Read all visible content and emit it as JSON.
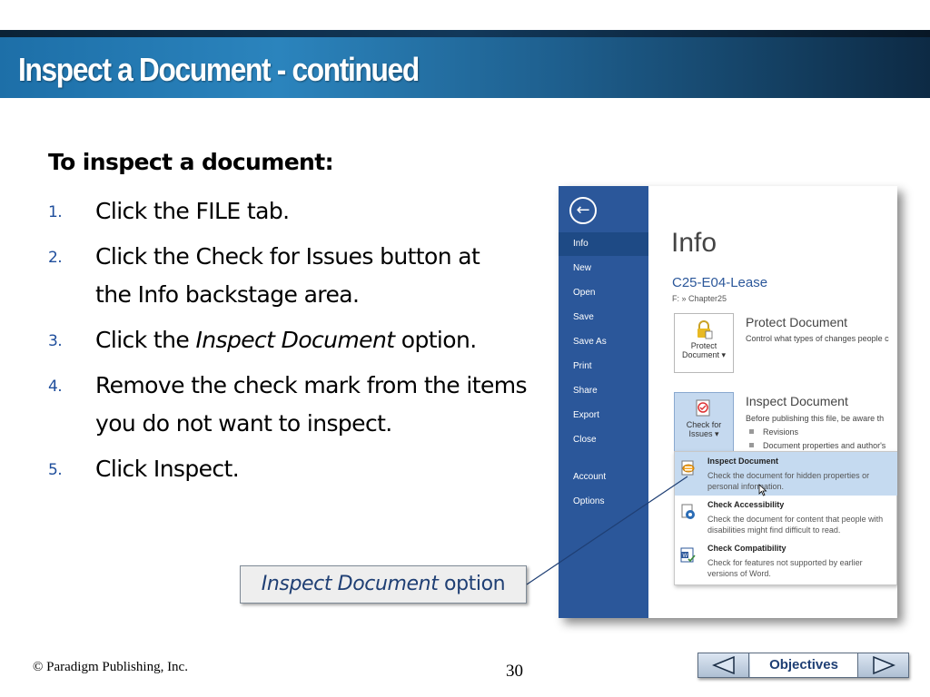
{
  "title": "Inspect a Document - continued",
  "heading": "To inspect a document:",
  "steps": [
    {
      "num": "1.",
      "text": "Click the FILE tab."
    },
    {
      "num": "2.",
      "text": "Click the Check for Issues button at the Info backstage area."
    },
    {
      "num": "3.",
      "pre": "Click the ",
      "em": "Inspect Document",
      "post": " option."
    },
    {
      "num": "4.",
      "text": "Remove the check mark from the items you do not want to inspect."
    },
    {
      "num": "5.",
      "text": "Click Inspect."
    }
  ],
  "screenshot": {
    "back_icon": "arrow-left-circle",
    "nav_items": [
      "Info",
      "New",
      "Open",
      "Save",
      "Save As",
      "Print",
      "Share",
      "Export",
      "Close",
      "Account",
      "Options"
    ],
    "nav_active": "Info",
    "info_title": "Info",
    "doc_name": "C25-E04-Lease",
    "doc_path": "F: » Chapter25",
    "protect": {
      "tile_line1": "Protect",
      "tile_line2": "Document ▾",
      "title": "Protect Document",
      "desc": "Control what types of changes people c"
    },
    "inspect": {
      "tile_line1": "Check for",
      "tile_line2": "Issues ▾",
      "title": "Inspect Document",
      "desc": "Before publishing this file, be aware th",
      "bullets": [
        "Revisions",
        "Document properties and author's"
      ]
    },
    "dropdown": [
      {
        "title": "Inspect Document",
        "desc": "Check the document for hidden properties or personal information.",
        "highlighted": true
      },
      {
        "title": "Check Accessibility",
        "desc": "Check the document for content that people with disabilities might find difficult to read.",
        "highlighted": false
      },
      {
        "title": "Check Compatibility",
        "desc": "Check for features not supported by earlier versions of Word.",
        "highlighted": false
      }
    ]
  },
  "callout": {
    "em": "Inspect Document",
    "post": " option"
  },
  "footer": {
    "copyright": "© Paradigm Publishing, Inc.",
    "page_number": "30",
    "objectives_label": "Objectives",
    "prev_icon": "triangle-left",
    "next_icon": "triangle-right"
  },
  "colors": {
    "nav_blue": "#2b579a",
    "step_number": "#1f4e9c",
    "doc_name": "#2b579a"
  }
}
